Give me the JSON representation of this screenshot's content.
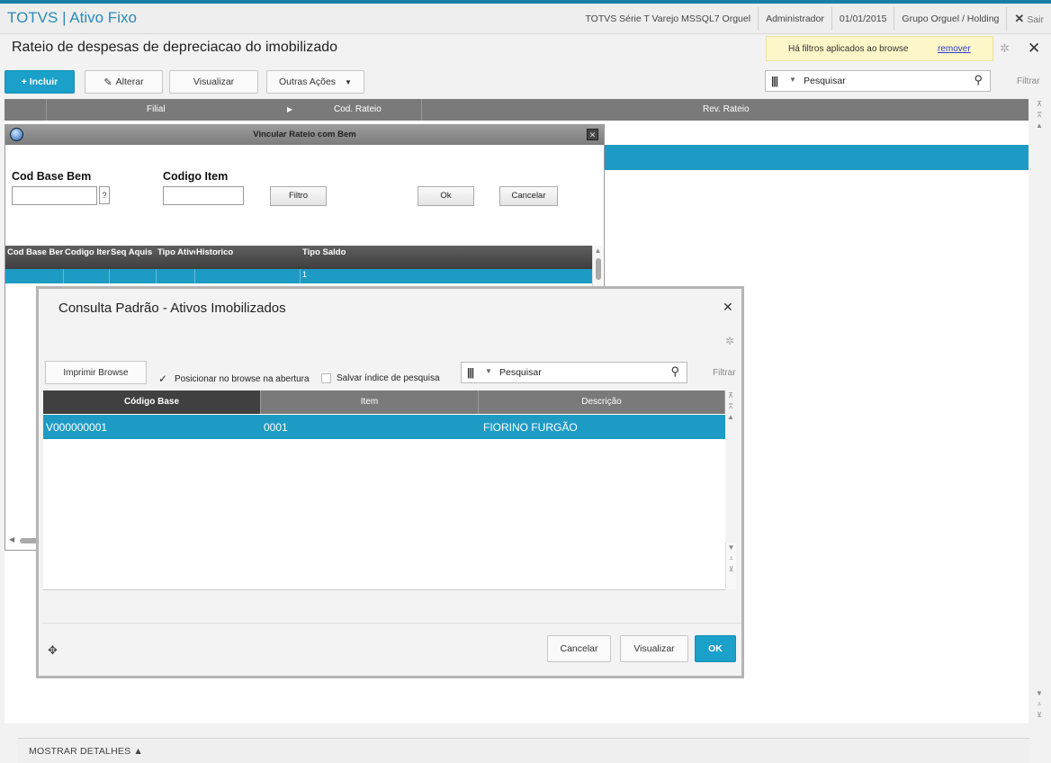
{
  "app": {
    "title": "TOTVS | Ativo Fixo"
  },
  "topbar": {
    "environment": "TOTVS Série T Varejo MSSQL7 Orguel",
    "user": "Administrador",
    "date": "01/01/2015",
    "company": "Grupo Orguel / Holding",
    "logout_icon": "✕",
    "logout": "Sair"
  },
  "page": {
    "title": "Rateio de despesas de depreciacao do imobilizado",
    "filter_notice": "Há filtros aplicados ao browse",
    "filter_remove": "remover"
  },
  "toolbar": {
    "incluir": "+ Incluir",
    "alterar": "Alterar",
    "visualizar": "Visualizar",
    "outras_acoes": "Outras Ações",
    "search_placeholder": "Pesquisar",
    "filtrar": "Filtrar"
  },
  "main_grid": {
    "columns": [
      "Filial",
      "Cod. Rateio",
      "Rev. Rateio"
    ]
  },
  "vincular_dialog": {
    "title": "Vincular Rateio com Bem",
    "cod_base_bem_label": "Cod Base Bem",
    "codigo_item_label": "Codigo Item",
    "lookup": "?",
    "filtro": "Filtro",
    "ok": "Ok",
    "cancelar": "Cancelar",
    "columns": [
      "Cod Base Bem",
      "Codigo Item",
      "Seq Aquis",
      "Tipo Ativo",
      "Historico",
      "Tipo Saldo"
    ],
    "row": {
      "tipo_saldo": "1"
    }
  },
  "consulta_dialog": {
    "title": "Consulta Padrão - Ativos Imobilizados",
    "imprimir": "Imprimir Browse",
    "posicionar": "Posicionar no browse na abertura",
    "posicionar_checked": true,
    "salvar_indice": "Salvar índice de pesquisa",
    "salvar_indice_checked": false,
    "search_placeholder": "Pesquisar",
    "filtrar": "Filtrar",
    "columns": [
      "Código Base",
      "Item",
      "Descrição"
    ],
    "rows": [
      {
        "codigo_base": "V000000001",
        "item": "0001",
        "descricao": "FIORINO FURGÃO"
      }
    ],
    "cancelar": "Cancelar",
    "visualizar": "Visualizar",
    "ok": "OK"
  },
  "bottom": {
    "mostrar_detalhes": "MOSTRAR DETALHES ▲"
  },
  "colors": {
    "accent": "#1aa0c9",
    "selection": "#1e9bc4",
    "title_blue": "#2a8ab5"
  }
}
